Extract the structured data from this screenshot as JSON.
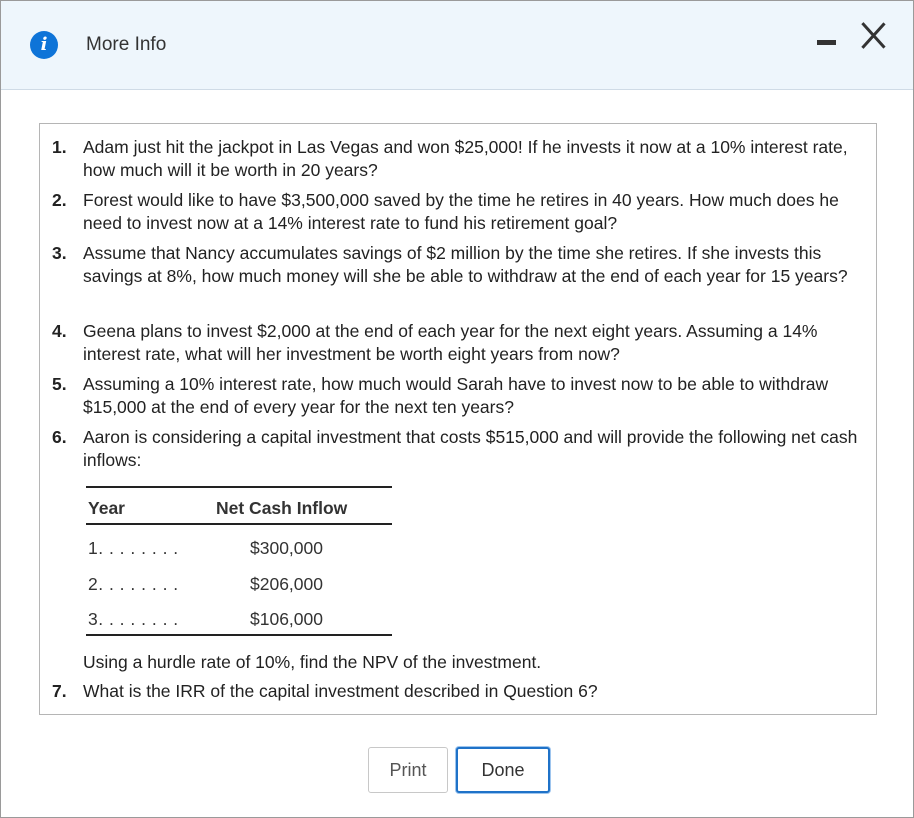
{
  "window": {
    "title": "More Info",
    "accent_color": "#0e74d8",
    "header_bg": "#eef6fc",
    "icons": {
      "info": "info-icon",
      "minimize": "minimize-icon",
      "close": "close-icon"
    }
  },
  "questions": [
    {
      "num": "1.",
      "text": "Adam just hit the jackpot in Las Vegas and won $25,000! If he invests it now at a 10% interest rate, how much will it be worth in 20 years?"
    },
    {
      "num": "2.",
      "text": "Forest would like to have $3,500,000 saved by the time he retires in 40 years. How much does he need to invest now at a 14% interest rate to fund his retirement goal?"
    },
    {
      "num": "3.",
      "text": "Assume that Nancy accumulates savings of $2 million by the time she retires. If she invests this savings at 8%, how much money will she be able to withdraw at the end of each year for 15 years?"
    },
    {
      "num": "4.",
      "text": "Geena plans to invest $2,000 at the end of each year for the next eight years. Assuming a 14% interest rate, what will her investment be worth eight years from now?"
    },
    {
      "num": "5.",
      "text": "Assuming a 10% interest rate, how much would Sarah have to invest now to be able to withdraw $15,000 at the end of every year for the next ten years?"
    },
    {
      "num": "6.",
      "text": "Aaron is considering a capital investment that costs $515,000 and will provide the following net cash inflows:"
    },
    {
      "num": "7.",
      "text": "What is the IRR of the capital investment described in Question 6?"
    }
  ],
  "cash_table": {
    "headers": {
      "year": "Year",
      "inflow": "Net Cash Inflow"
    },
    "rows": [
      {
        "year": "1. . . . . . . .",
        "value": "$300,000"
      },
      {
        "year": "2. . . . . . . .",
        "value": "$206,000"
      },
      {
        "year": "3. . . . . . . .",
        "value": "$106,000"
      }
    ]
  },
  "hurdle_text": "Using a hurdle rate of 10%, find the NPV of the investment.",
  "buttons": {
    "print": "Print",
    "done": "Done"
  }
}
